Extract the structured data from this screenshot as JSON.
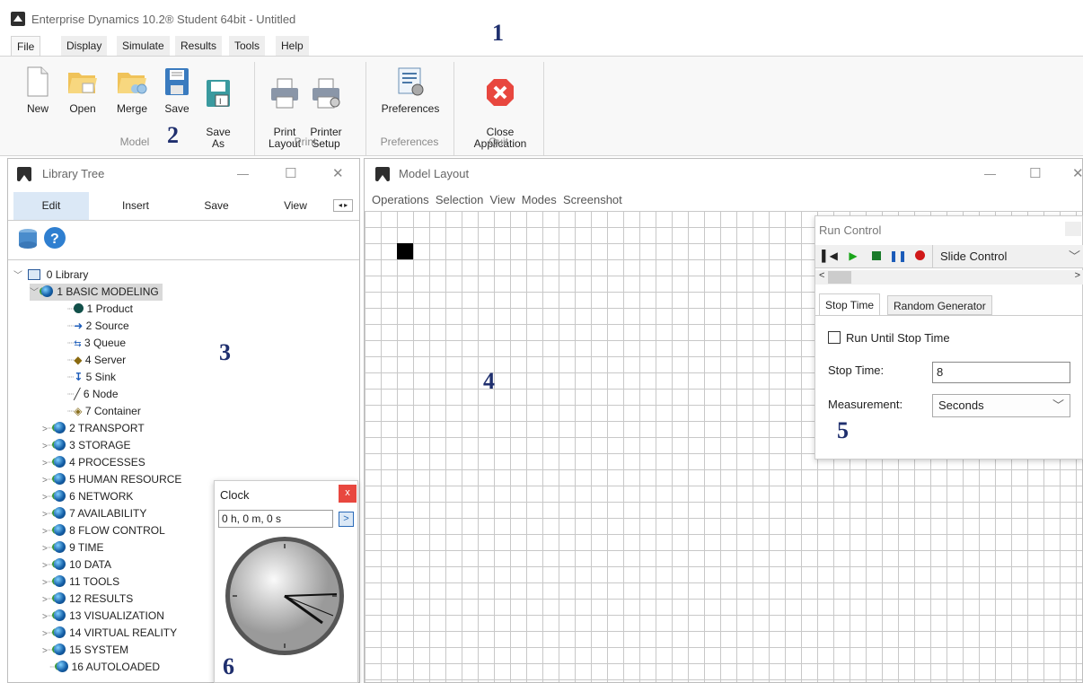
{
  "app": {
    "title": "Enterprise Dynamics 10.2® Student 64bit - Untitled"
  },
  "menu_tabs": [
    "File",
    "Display",
    "Simulate",
    "Results",
    "Tools",
    "Help"
  ],
  "ribbon": {
    "buttons": [
      {
        "label": "New",
        "icon": "new-document-icon"
      },
      {
        "label": "Open",
        "icon": "open-folder-icon"
      },
      {
        "label": "Merge",
        "icon": "merge-folder-icon"
      },
      {
        "label": "Save",
        "icon": "floppy-save-icon"
      },
      {
        "label": "Save\nAs",
        "icon": "floppy-save-as-icon"
      },
      {
        "label": "Print\nLayout",
        "icon": "printer-icon"
      },
      {
        "label": "Printer\nSetup",
        "icon": "printer-setup-icon"
      },
      {
        "label": "Preferences",
        "icon": "preferences-icon"
      },
      {
        "label": "Close\nApplication",
        "icon": "close-app-icon"
      }
    ],
    "groups": [
      "Model",
      "Print",
      "Preferences",
      "Quit"
    ]
  },
  "library_tree": {
    "title": "Library Tree",
    "tabs": [
      "Edit",
      "Insert",
      "Save",
      "View"
    ],
    "root": "0 Library",
    "expanded": "1 BASIC MODELING",
    "children": [
      "1 Product",
      "2 Source",
      "3 Queue",
      "4 Server",
      "5 Sink",
      "6 Node",
      "7 Container"
    ],
    "groups": [
      "2 TRANSPORT",
      "3 STORAGE",
      "4 PROCESSES",
      "5 HUMAN RESOURCE",
      "6 NETWORK",
      "7 AVAILABILITY",
      "8 FLOW CONTROL",
      "9 TIME",
      "10 DATA",
      "11 TOOLS",
      "12 RESULTS",
      "13 VISUALIZATION",
      "14 VIRTUAL REALITY",
      "15 SYSTEM",
      "16 AUTOLOADED"
    ]
  },
  "model_layout": {
    "title": "Model Layout",
    "menu": [
      "Operations",
      "Selection",
      "View",
      "Modes",
      "Screenshot"
    ]
  },
  "run_control": {
    "title": "Run Control",
    "slide_control": "Slide Control",
    "tabs": [
      "Stop Time",
      "Random Generator"
    ],
    "run_until_label": "Run Until Stop Time",
    "stop_time_label": "Stop Time:",
    "stop_time_value": "8",
    "measurement_label": "Measurement:",
    "measurement_value": "Seconds"
  },
  "clock": {
    "title": "Clock",
    "value": "0 h, 0 m, 0 s",
    "close": "x"
  },
  "annotations": [
    "1",
    "2",
    "3",
    "4",
    "5",
    "6"
  ],
  "colors": {
    "accent": "#1f2f6e",
    "close_red": "#e8473f",
    "tab_blue": "#dbe8f6"
  }
}
